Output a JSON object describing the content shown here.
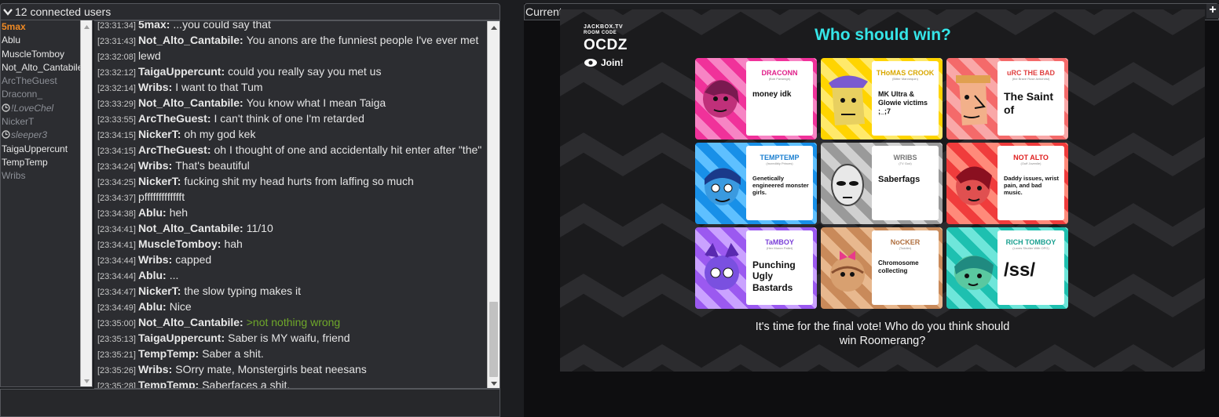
{
  "userlist": {
    "toggle_label": "12 connected users",
    "users": [
      {
        "name": "5max",
        "cls": "user me"
      },
      {
        "name": "Ablu",
        "cls": "user rank2"
      },
      {
        "name": "MuscleTomboy",
        "cls": "user rank2"
      },
      {
        "name": "Not_Alto_Cantabile",
        "cls": "user rank2"
      },
      {
        "name": "ArcTheGuest",
        "cls": "user"
      },
      {
        "name": "Draconn_",
        "cls": "user"
      },
      {
        "name": "!LoveChel",
        "cls": "user afk",
        "afk": true
      },
      {
        "name": "NickerT",
        "cls": "user"
      },
      {
        "name": "sleeper3",
        "cls": "user afk",
        "afk": true
      },
      {
        "name": "TaigaUppercunt",
        "cls": "user rank2"
      },
      {
        "name": "TempTemp",
        "cls": "user rank2"
      },
      {
        "name": "Wribs",
        "cls": "user"
      }
    ]
  },
  "chat": {
    "messages": [
      {
        "ts": "[23:31:34]",
        "user": "5max:",
        "text": "...you could say that"
      },
      {
        "ts": "[23:31:43]",
        "user": "Not_Alto_Cantabile:",
        "text": "You anons are the funniest people I've ever met"
      },
      {
        "ts": "[23:32:08]",
        "user": "",
        "text": "lewd"
      },
      {
        "ts": "[23:32:12]",
        "user": "TaigaUppercunt:",
        "text": "could you really say you met us"
      },
      {
        "ts": "[23:32:14]",
        "user": "Wribs:",
        "text": "I want to that Tum"
      },
      {
        "ts": "[23:33:29]",
        "user": "Not_Alto_Cantabile:",
        "text": "You know what I mean Taiga"
      },
      {
        "ts": "[23:33:55]",
        "user": "ArcTheGuest:",
        "text": "I can't think of one I'm retarded"
      },
      {
        "ts": "[23:34:15]",
        "user": "NickerT:",
        "text": "oh my god kek"
      },
      {
        "ts": "[23:34:15]",
        "user": "ArcTheGuest:",
        "text": "oh I thought of one and accidentally hit enter after \"the\""
      },
      {
        "ts": "[23:34:24]",
        "user": "Wribs:",
        "text": "That's beautiful"
      },
      {
        "ts": "[23:34:25]",
        "user": "NickerT:",
        "text": "fucking shit my head hurts from laffing so much"
      },
      {
        "ts": "[23:34:37]",
        "user": "",
        "text": "pffffffffffffft"
      },
      {
        "ts": "[23:34:38]",
        "user": "Ablu:",
        "text": "heh"
      },
      {
        "ts": "[23:34:41]",
        "user": "Not_Alto_Cantabile:",
        "text": "11/10"
      },
      {
        "ts": "[23:34:41]",
        "user": "MuscleTomboy:",
        "text": "hah"
      },
      {
        "ts": "[23:34:44]",
        "user": "Wribs:",
        "text": "capped"
      },
      {
        "ts": "[23:34:44]",
        "user": "Ablu:",
        "text": "..."
      },
      {
        "ts": "[23:34:47]",
        "user": "NickerT:",
        "text": "the slow typing makes it"
      },
      {
        "ts": "[23:34:49]",
        "user": "Ablu:",
        "text": "Nice"
      },
      {
        "ts": "[23:35:00]",
        "user": "Not_Alto_Cantabile:",
        "text": ">not nothing wrong",
        "greentext": true
      },
      {
        "ts": "[23:35:13]",
        "user": "TaigaUppercunt:",
        "text": "Saber is MY waifu, friend"
      },
      {
        "ts": "[23:35:21]",
        "user": "TempTemp:",
        "text": "Saber a shit."
      },
      {
        "ts": "[23:35:26]",
        "user": "Wribs:",
        "text": "SOrry mate, Monstergirls beat neesans"
      },
      {
        "ts": "[23:35:28]",
        "user": "TempTemp:",
        "text": "Saberfaces a shit."
      }
    ],
    "scroll_position": 0.93
  },
  "video": {
    "title": "Current",
    "plus": "+",
    "jackbox": {
      "site": "JACKBOX.TV",
      "room_code_label": "ROOM CODE",
      "room_code": "OCDZ",
      "join": "Join!"
    },
    "question": "Who should win?",
    "caption": "It's time for the final vote! Who do you think should win Roomerang?",
    "cards": [
      {
        "name": "DRACONN",
        "sub": "(Bob Parsleigh)",
        "answer": "money idk",
        "name_color": "#e0208a",
        "bg": "#f0329a",
        "bg2": "#f784c4",
        "face": "#c0307a",
        "ans_size": 10
      },
      {
        "name": "THoMAS CROOK",
        "sub": "(Bitter Mannequin)",
        "answer": "MK Ultra & Glowie victims ;_;7",
        "name_color": "#d9a800",
        "bg": "#ffd400",
        "bg2": "#ffe96a",
        "face": "#e8d060",
        "ans_size": 9
      },
      {
        "name": "uRC THE BAD",
        "sub": "(the Brave Ruse Antichrist)",
        "answer": "The Saint of",
        "name_color": "#e04040",
        "bg": "#f46a6a",
        "bg2": "#f9a8a8",
        "face": "#f2b08a",
        "ans_size": 14
      },
      {
        "name": "TEMPTEMP",
        "sub": "(Incredibly Princes)",
        "answer": "Genetically engineered monster girls.",
        "name_color": "#1a7fd0",
        "bg": "#1890e8",
        "bg2": "#5ec0ff",
        "face": "#3a9ae0",
        "ans_size": 7.5
      },
      {
        "name": "WRIBS",
        "sub": "(TV God)",
        "answer": "Saberfags",
        "name_color": "#777777",
        "bg": "#9a9a9a",
        "bg2": "#d0d0d0",
        "face": "#e8e8e8",
        "ans_size": 11
      },
      {
        "name": "NOT ALTO",
        "sub": "(Ouff Juvenile)",
        "answer": "Daddy issues, wrist pain, and bad music.",
        "name_color": "#e02020",
        "bg": "#f03c3c",
        "bg2": "#ff8a7a",
        "face": "#e05050",
        "ans_size": 7.5
      },
      {
        "name": "TaMBOY",
        "sub": "(Hex Moron Pallet)",
        "answer": "Punching Ugly Bastards",
        "name_color": "#7a3fd8",
        "bg": "#9b59f0",
        "bg2": "#caa2ff",
        "face": "#7a50e0",
        "ans_size": 12
      },
      {
        "name": "NoCKER",
        "sub": "(Toddler)",
        "answer": "Chromosome collecting",
        "name_color": "#b07040",
        "bg": "#c98a5a",
        "bg2": "#e8b88e",
        "face": "#d8a070",
        "ans_size": 8
      },
      {
        "name": "RICH TOMBOY",
        "sub": "(Loves Shutter With OPG)",
        "answer": "/ss/",
        "name_color": "#1aa090",
        "bg": "#1ec0b0",
        "bg2": "#6ee6da",
        "face": "#208a80",
        "ans_size": 24
      }
    ]
  }
}
